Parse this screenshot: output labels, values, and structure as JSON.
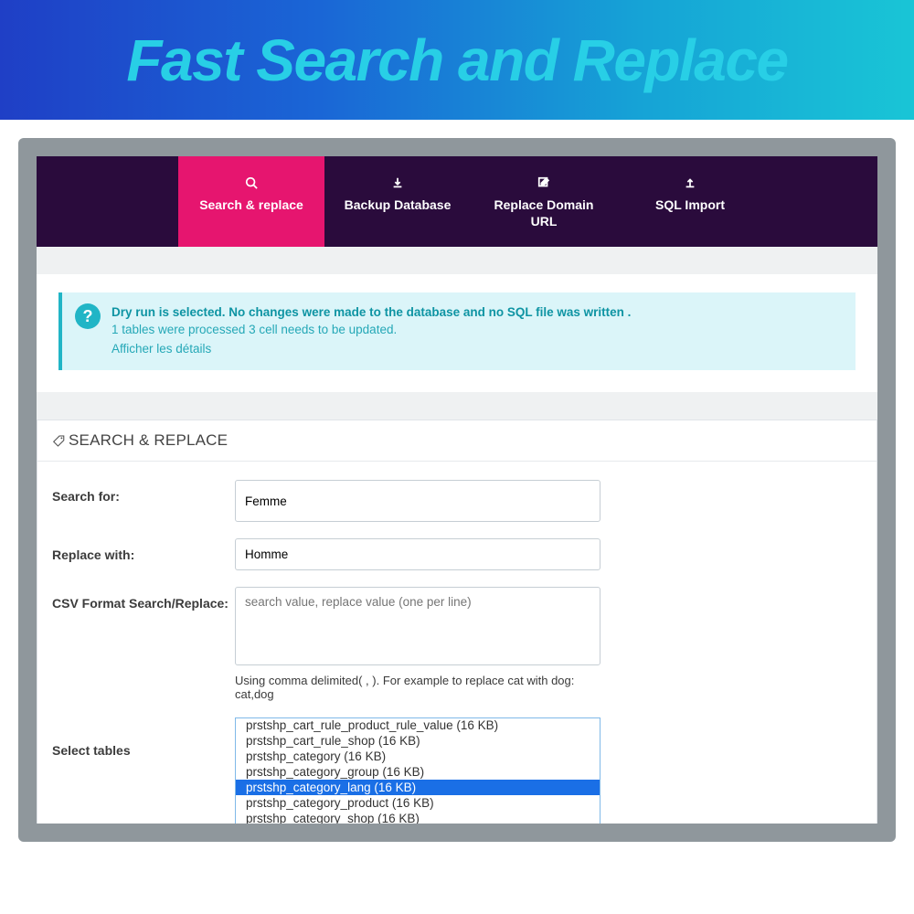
{
  "hero": {
    "title": "Fast Search and Replace"
  },
  "tabs": [
    {
      "label": "Search & replace",
      "active": true
    },
    {
      "label": "Backup Database",
      "active": false
    },
    {
      "label": "Replace Domain URL",
      "active": false
    },
    {
      "label": "SQL Import",
      "active": false
    }
  ],
  "alert": {
    "line1": "Dry run is selected. No changes were made to the database and no SQL file was written .",
    "line2": "1 tables were processed 3 cell needs to be updated.",
    "details_link": "Afficher les détails"
  },
  "panel": {
    "title": "SEARCH & REPLACE"
  },
  "form": {
    "search_for": {
      "label": "Search for:",
      "value": "Femme"
    },
    "replace_with": {
      "label": "Replace with:",
      "value": "Homme"
    },
    "csv": {
      "label": "CSV Format Search/Replace:",
      "placeholder": "search value, replace value (one per line)",
      "hint": "Using comma delimited( , ). For example to replace cat with dog: cat,dog"
    },
    "select_tables": {
      "label": "Select tables",
      "options": [
        {
          "text": "prstshp_cart_rule_product_rule_value (16 KB)",
          "selected": false
        },
        {
          "text": "prstshp_cart_rule_shop (16 KB)",
          "selected": false
        },
        {
          "text": "prstshp_category (16 KB)",
          "selected": false
        },
        {
          "text": "prstshp_category_group (16 KB)",
          "selected": false
        },
        {
          "text": "prstshp_category_lang (16 KB)",
          "selected": true
        },
        {
          "text": "prstshp_category_product (16 KB)",
          "selected": false
        },
        {
          "text": "prstshp_category_shop (16 KB)",
          "selected": false
        }
      ]
    }
  }
}
